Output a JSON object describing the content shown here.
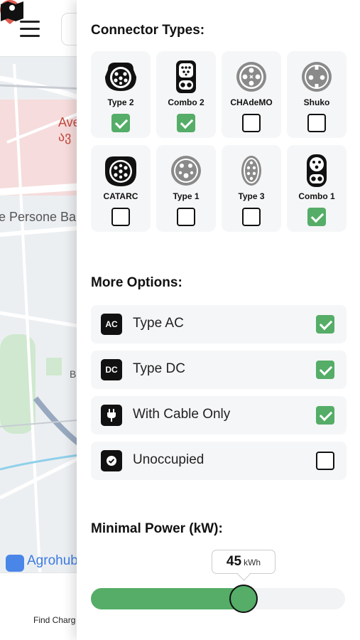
{
  "map": {
    "labels": {
      "hospital": "Ave",
      "hospital_sub": "ავ",
      "street": "e Persone Ba",
      "place": "B",
      "agro": "Agrohub"
    },
    "bottom_nav": {
      "find_label": "Find Charg"
    }
  },
  "filters": {
    "connector_title": "Connector Types:",
    "connectors": [
      {
        "label": "Type 2",
        "icon": "type2-connector-icon",
        "checked": true
      },
      {
        "label": "Combo 2",
        "icon": "combo2-connector-icon",
        "checked": true
      },
      {
        "label": "CHAdeMO",
        "icon": "chademo-connector-icon",
        "checked": false
      },
      {
        "label": "Shuko",
        "icon": "shuko-connector-icon",
        "checked": false
      },
      {
        "label": "CATARC",
        "icon": "catarc-connector-icon",
        "checked": false
      },
      {
        "label": "Type 1",
        "icon": "type1-connector-icon",
        "checked": false
      },
      {
        "label": "Type 3",
        "icon": "type3-connector-icon",
        "checked": false
      },
      {
        "label": "Combo 1",
        "icon": "combo1-connector-icon",
        "checked": true
      }
    ],
    "options_title": "More Options:",
    "options": [
      {
        "badge": "AC",
        "label": "Type AC",
        "icon": "ac-badge-icon",
        "checked": true
      },
      {
        "badge": "DC",
        "label": "Type DC",
        "icon": "dc-badge-icon",
        "checked": true
      },
      {
        "badge": "",
        "label": "With Cable Only",
        "icon": "plug-icon",
        "checked": true
      },
      {
        "badge": "",
        "label": "Unoccupied",
        "icon": "check-circle-icon",
        "checked": false
      }
    ],
    "power_title": "Minimal Power (kW):",
    "power": {
      "value": "45",
      "unit": "kWh",
      "fraction": 0.6
    }
  },
  "colors": {
    "accent": "#55ad68",
    "card": "#f5f6f7",
    "dark": "#111111"
  }
}
